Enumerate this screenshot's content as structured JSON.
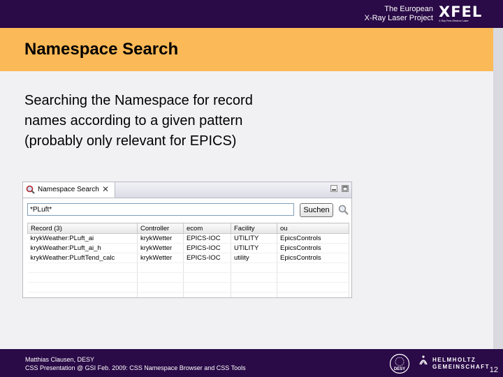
{
  "header": {
    "org_line1": "The European",
    "org_line2": "X-Ray Laser Project",
    "logo_text": "XFEL",
    "logo_subtext": "X-Ray Free-Electron Laser"
  },
  "slide": {
    "title": "Namespace Search",
    "body_lines": [
      "Searching the Namespace for record",
      "names according to a given pattern",
      "(probably only relevant for EPICS)"
    ]
  },
  "view": {
    "tab_label": "Namespace Search",
    "tab_icon": "magnifier-icon",
    "search_value": "*PLuft*",
    "search_button": "Suchen",
    "columns": [
      "Record (3)",
      "Controller",
      "ecom",
      "Facility",
      "ou"
    ],
    "rows": [
      [
        "krykWeather:PLuft_ai",
        "krykWetter",
        "EPICS-IOC",
        "UTILITY",
        "EpicsControls"
      ],
      [
        "krykWeather:PLuft_ai_h",
        "krykWetter",
        "EPICS-IOC",
        "UTILITY",
        "EpicsControls"
      ],
      [
        "krykWeather:PLuftTend_calc",
        "krykWetter",
        "EPICS-IOC",
        "utility",
        "EpicsControls"
      ]
    ]
  },
  "footer": {
    "line1": "Matthias Clausen, DESY",
    "line2": "CSS Presentation @ GSI Feb. 2009: CSS Namespace Browser and CSS Tools",
    "desy_label": "DESY",
    "helmholtz_line1": "HELMHOLTZ",
    "helmholtz_line2": "GEMEINSCHAFT",
    "page_number": "12"
  },
  "colors": {
    "banner": "#2a0a47",
    "title_band": "#fbb957",
    "content_bg": "#f1f1f3"
  }
}
